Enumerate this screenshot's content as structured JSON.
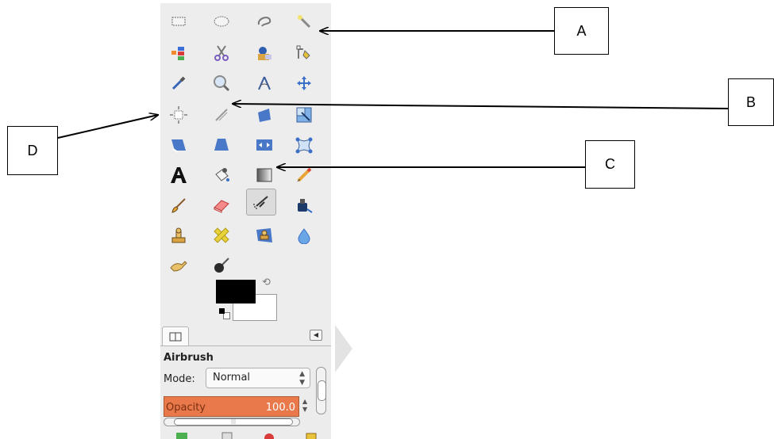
{
  "toolbox": {
    "tools": [
      {
        "name": "rect-select-icon"
      },
      {
        "name": "ellipse-select-icon"
      },
      {
        "name": "free-select-icon"
      },
      {
        "name": "fuzzy-select-icon"
      },
      {
        "name": "select-by-color-icon"
      },
      {
        "name": "scissors-select-icon"
      },
      {
        "name": "foreground-select-icon"
      },
      {
        "name": "paths-icon"
      },
      {
        "name": "color-picker-icon"
      },
      {
        "name": "zoom-icon"
      },
      {
        "name": "measure-icon"
      },
      {
        "name": "move-icon"
      },
      {
        "name": "align-icon"
      },
      {
        "name": "crop-icon"
      },
      {
        "name": "rotate-icon"
      },
      {
        "name": "scale-icon"
      },
      {
        "name": "shear-icon"
      },
      {
        "name": "perspective-icon"
      },
      {
        "name": "flip-icon"
      },
      {
        "name": "cage-transform-icon"
      },
      {
        "name": "text-icon"
      },
      {
        "name": "bucket-fill-icon"
      },
      {
        "name": "blend-icon"
      },
      {
        "name": "pencil-icon"
      },
      {
        "name": "paintbrush-icon"
      },
      {
        "name": "eraser-icon"
      },
      {
        "name": "airbrush-icon",
        "active": true
      },
      {
        "name": "ink-icon"
      },
      {
        "name": "clone-icon"
      },
      {
        "name": "heal-icon"
      },
      {
        "name": "perspective-clone-icon"
      },
      {
        "name": "blur-icon"
      },
      {
        "name": "smudge-icon"
      },
      {
        "name": "dodge-burn-icon"
      }
    ],
    "colors": {
      "foreground": "#000000",
      "background": "#ffffff"
    }
  },
  "tool_options": {
    "title": "Airbrush",
    "mode_label": "Mode:",
    "mode_value": "Normal",
    "opacity_label": "Opacity",
    "opacity_value": "100.0",
    "opacity_color": "#e9784b"
  },
  "callouts": {
    "a": "A",
    "b": "B",
    "c": "C",
    "d": "D"
  }
}
